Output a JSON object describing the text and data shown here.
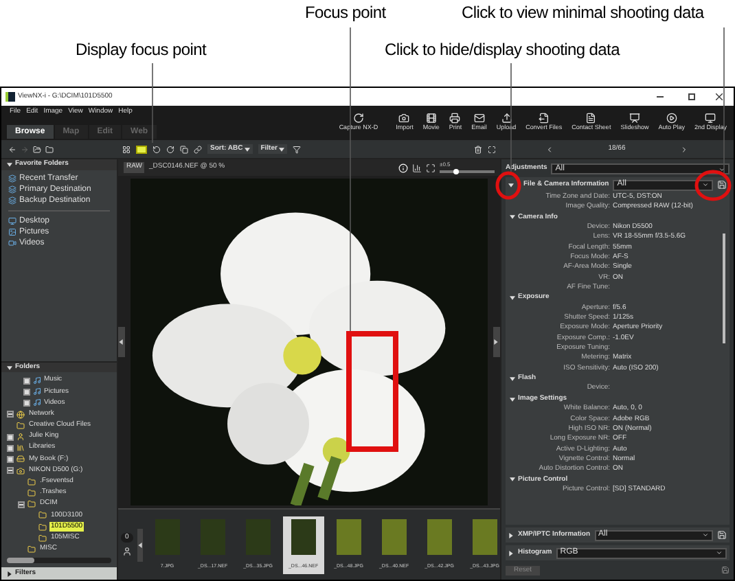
{
  "annotations": [
    {
      "text": "Focus point"
    },
    {
      "text": "Click to view minimal shooting data"
    },
    {
      "text": "Display focus point"
    },
    {
      "text": "Click to hide/display shooting data"
    }
  ],
  "window": {
    "title": "ViewNX-i - G:\\DCIM\\101D5500"
  },
  "menu": [
    "File",
    "Edit",
    "Image",
    "View",
    "Window",
    "Help"
  ],
  "tabs": [
    {
      "label": "Browse",
      "selected": true
    },
    {
      "label": "Map",
      "selected": false
    },
    {
      "label": "Edit",
      "selected": false
    },
    {
      "label": "Web",
      "selected": false
    }
  ],
  "toolbar": [
    {
      "label": "Capture NX-D",
      "kind": "capture"
    },
    {
      "label": "Import",
      "kind": "import"
    },
    {
      "label": "Movie",
      "kind": "movie"
    },
    {
      "label": "Print",
      "kind": "print"
    },
    {
      "label": "Email",
      "kind": "email"
    },
    {
      "label": "Upload",
      "kind": "upload"
    },
    {
      "label": "Convert Files",
      "kind": "convert"
    },
    {
      "label": "Contact Sheet",
      "kind": "sheet"
    },
    {
      "label": "Slideshow",
      "kind": "slideshow"
    },
    {
      "label": "Auto Play",
      "kind": "autoplay"
    },
    {
      "label": "2nd Display",
      "kind": "display"
    }
  ],
  "favorites": {
    "title": "Favorite Folders",
    "items": [
      {
        "label": "Recent Transfer",
        "kind": "nikon"
      },
      {
        "label": "Primary Destination",
        "kind": "nikon"
      },
      {
        "label": "Backup Destination",
        "kind": "nikon"
      },
      {
        "label": "Desktop",
        "kind": "desktop"
      },
      {
        "label": "Pictures",
        "kind": "pictures"
      },
      {
        "label": "Videos",
        "kind": "videos"
      }
    ]
  },
  "folders": {
    "title": "Folders",
    "partial": [
      {
        "label": "Music",
        "expanded": false
      },
      {
        "label": "Pictures",
        "expanded": false
      },
      {
        "label": "Videos",
        "expanded": false
      }
    ],
    "tree": [
      {
        "label": "Network",
        "expanded": true,
        "selected": false
      },
      {
        "label": "Creative Cloud Files",
        "selected": false
      },
      {
        "label": "Julie King",
        "expanded": false,
        "selected": false
      },
      {
        "label": "Libraries",
        "expanded": false,
        "selected": false
      },
      {
        "label": "My Book (F:)",
        "expanded": false,
        "selected": false
      },
      {
        "label": "NIKON D500 (G:)",
        "expanded": true,
        "selected": false,
        "children": [
          {
            "label": ".Fseventsd",
            "selected": false
          },
          {
            "label": ".Trashes",
            "selected": false
          },
          {
            "label": "DCIM",
            "expanded": true,
            "selected": false,
            "children": [
              {
                "label": "100D3100",
                "selected": false
              },
              {
                "label": "101D5500",
                "selected": true
              },
              {
                "label": "105MISC",
                "selected": false
              }
            ]
          },
          {
            "label": "MISC",
            "selected": false
          }
        ]
      }
    ]
  },
  "filters": {
    "title": "Filters"
  },
  "center_toolbar": {
    "focus_point": {
      "on": true
    },
    "sort": "Sort: ABC",
    "filter": "Filter"
  },
  "viewer": {
    "format": "RAW",
    "file": "_DSC0146.NEF @ 50 %",
    "exposure": "±0.5",
    "level": 0.3
  },
  "filmstrip": {
    "count": "0",
    "thumbnails": [
      {
        "label": "7.JPG",
        "selected": false
      },
      {
        "label": "_DS...17.NEF",
        "selected": false
      },
      {
        "label": "_DS...35.JPG",
        "selected": false
      },
      {
        "label": "_DS...46.NEF",
        "selected": true
      },
      {
        "label": "_DS...48.JPG",
        "selected": false
      },
      {
        "label": "_DS...40.NEF",
        "selected": false
      },
      {
        "label": "_DS...42.JPG",
        "selected": false
      },
      {
        "label": "_DS...43.JPG",
        "selected": false
      }
    ]
  },
  "right_panel": {
    "position": "18/66",
    "adjustments": {
      "label": "Adjustments",
      "value": "All"
    },
    "info": {
      "label": "File & Camera Information",
      "value": "All",
      "expanded": true
    },
    "rows": [
      {
        "label": "Time Zone and Date:",
        "value": "UTC-5, DST:ON"
      },
      {
        "label": "Image Quality:",
        "value": "Compressed RAW (12-bit)"
      }
    ],
    "sections": [
      {
        "title": "Camera Info",
        "expanded": true,
        "rows": [
          {
            "label": "Device:",
            "value": "Nikon D5500"
          },
          {
            "label": "Lens:",
            "value": "VR 18-55mm f/3.5-5.6G"
          },
          {
            "label": "Focal Length:",
            "value": "55mm"
          },
          {
            "label": "Focus Mode:",
            "value": "AF-S"
          },
          {
            "label": "AF-Area Mode:",
            "value": "Single"
          },
          {
            "label": "VR:",
            "value": "ON"
          },
          {
            "label": "AF Fine Tune:"
          }
        ]
      },
      {
        "title": "Exposure",
        "expanded": true,
        "rows": [
          {
            "label": "Aperture:",
            "value": "f/5.6"
          },
          {
            "label": "Shutter Speed:",
            "value": "1/125s"
          },
          {
            "label": "Exposure Mode:",
            "value": "Aperture Priority"
          },
          {
            "label": "Exposure Comp.:",
            "value": "-1.0EV"
          },
          {
            "label": "Exposure Tuning:"
          },
          {
            "label": "Metering:",
            "value": "Matrix"
          },
          {
            "label": "ISO Sensitivity:",
            "value": "Auto (ISO 200)"
          }
        ]
      },
      {
        "title": "Flash",
        "expanded": true,
        "rows": [
          {
            "label": "Device:"
          }
        ]
      },
      {
        "title": "Image Settings",
        "expanded": true,
        "rows": [
          {
            "label": "White Balance:",
            "value": "Auto, 0, 0"
          },
          {
            "label": "Color Space:",
            "value": "Adobe RGB"
          },
          {
            "label": "High ISO NR:",
            "value": "ON (Normal)"
          },
          {
            "label": "Long Exposure NR:",
            "value": "OFF"
          },
          {
            "label": "Active D-Lighting:",
            "value": "Auto"
          },
          {
            "label": "Vignette Control:",
            "value": "Normal"
          },
          {
            "label": "Auto Distortion Control:",
            "value": "ON"
          }
        ]
      },
      {
        "title": "Picture Control",
        "expanded": true,
        "rows": [
          {
            "label": "Picture Control:",
            "value": "[SD] STANDARD"
          }
        ]
      }
    ],
    "xmp": {
      "label": "XMP/IPTC Information",
      "value": "All",
      "expanded": false
    },
    "histogram": {
      "label": "Histogram",
      "value": "RGB",
      "expanded": false
    },
    "reset": "Reset"
  }
}
